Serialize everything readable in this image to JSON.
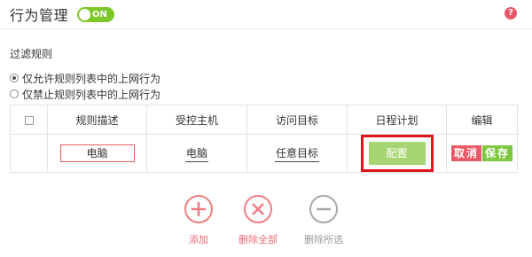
{
  "header": {
    "title": "行为管理",
    "toggle_label": "ON",
    "help_icon": "help-icon"
  },
  "filter": {
    "section_title": "过滤规则",
    "options": [
      {
        "label": "仅允许规则列表中的上网行为",
        "checked": true
      },
      {
        "label": "仅禁止规则列表中的上网行为",
        "checked": false
      }
    ]
  },
  "table": {
    "headers": [
      "规则描述",
      "受控主机",
      "访问目标",
      "日程计划",
      "编辑"
    ],
    "row": {
      "description": "电脑",
      "host": "电脑",
      "target": "任意目标",
      "schedule_button": "配置",
      "cancel_button": "取消",
      "save_button": "保存"
    }
  },
  "actions": {
    "add": "添加",
    "delete_all": "删除全部",
    "delete_selected": "删除所选"
  },
  "colors": {
    "accent_green": "#7ec829",
    "accent_red": "#e85a66",
    "highlight_border": "#e0141b"
  }
}
